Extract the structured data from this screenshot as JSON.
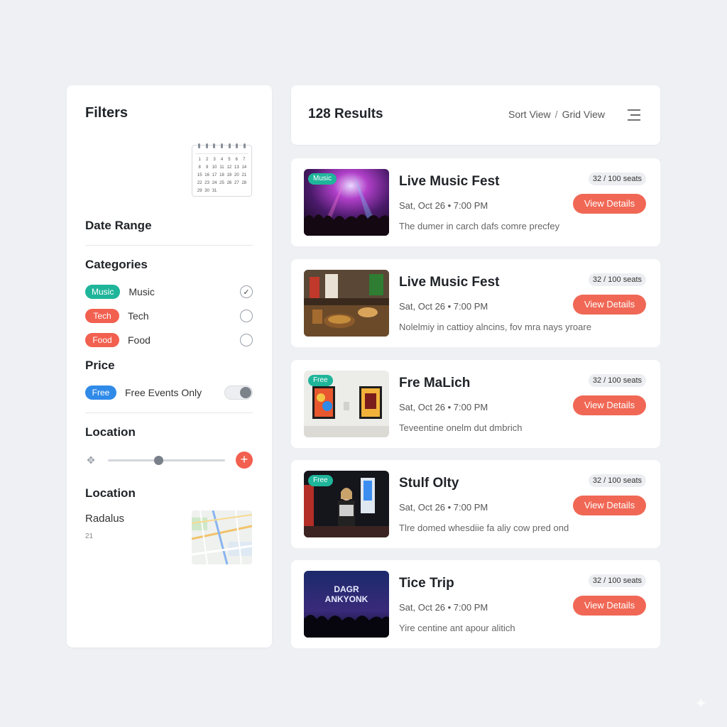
{
  "filters": {
    "title": "Filters",
    "calendar": {
      "rows": [
        [
          "1",
          "2",
          "3",
          "4",
          "5",
          "6",
          "7"
        ],
        [
          "8",
          "9",
          "10",
          "11",
          "12",
          "13",
          "14"
        ],
        [
          "15",
          "16",
          "17",
          "18",
          "19",
          "20",
          "21"
        ],
        [
          "22",
          "23",
          "24",
          "25",
          "26",
          "27",
          "28"
        ],
        [
          "29",
          "30",
          "31"
        ]
      ]
    },
    "date_range_label": "Date Range",
    "categories_label": "Categories",
    "categories": [
      {
        "pill": "Music",
        "name": "Music",
        "checked": true,
        "color": "#1fb59a"
      },
      {
        "pill": "Tech",
        "name": "Tech",
        "checked": false,
        "color": "#f2604f"
      },
      {
        "pill": "Food",
        "name": "Food",
        "checked": false,
        "color": "#f2604f"
      }
    ],
    "price_label": "Price",
    "price": {
      "pill": "Free",
      "text": "Free Events Only",
      "pill_color": "#2f8ae8",
      "toggle_on": true
    },
    "location_label": "Location",
    "slider_value_fraction": 0.43,
    "location2_label": "Location",
    "radius_label": "Radalus",
    "radius_value": "21"
  },
  "results": {
    "count": "128 Results",
    "sort_view": "Sort View",
    "separator": "/",
    "grid_view": "Grid View"
  },
  "events": [
    {
      "title": "Live Music Fest",
      "date": "Sat, Oct 26 • 7:00 PM",
      "desc": "The dumer in carch dafs comre precfey",
      "seats": "32 / 100 seats",
      "button": "View Details",
      "badge": "Music"
    },
    {
      "title": "Live Music Fest",
      "date": "Sat, Oct 26 • 7:00 PM",
      "desc": "Nolelmiy in cattioy alncins, fov mra nays yroare",
      "seats": "32 / 100 seats",
      "button": "View Details",
      "badge": ""
    },
    {
      "title": "Fre MaLich",
      "date": "Sat, Oct 26 • 7:00 PM",
      "desc": "Teveentine onelm dut dmbrich",
      "seats": "32 / 100 seats",
      "button": "View Details",
      "badge": "Free"
    },
    {
      "title": "Stulf Olty",
      "date": "Sat, Oct 26 • 7:00 PM",
      "desc": "Tlre domed whesdiie fa aliy cow pred ond",
      "seats": "32 / 100 seats",
      "button": "View Details",
      "badge": "Free"
    },
    {
      "title": "Tice Trip",
      "date": "Sat, Oct 26 • 7:00 PM",
      "desc": "Yire centine ant apour alitich",
      "seats": "32 / 100 seats",
      "button": "View Details",
      "badge": "",
      "thumb_text": "DAGR ANKYONK"
    }
  ],
  "colors": {
    "accent": "#f06855",
    "teal": "#1fb59a",
    "blue": "#2f8ae8"
  }
}
